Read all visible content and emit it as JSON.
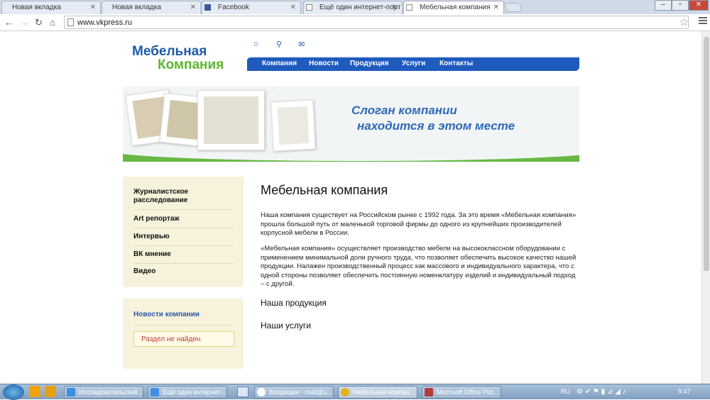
{
  "browser": {
    "tabs": [
      {
        "label": "Новая вкладка"
      },
      {
        "label": "Новая вкладка"
      },
      {
        "label": "Facebook"
      },
      {
        "label": "Ещё один интернет-порт"
      },
      {
        "label": "Мебельная компания"
      }
    ],
    "url": "www.vkpress.ru"
  },
  "site": {
    "logo_line1": "Мебельная",
    "logo_line2": "Компания",
    "nav": [
      "Компания",
      "Новости",
      "Продукция",
      "Услуги",
      "Контакты"
    ],
    "slogan_line1": "Слоган компании",
    "slogan_line2": "находится в этом месте"
  },
  "sidebar": {
    "items": [
      "Журналистское расследование",
      "Art репортаж",
      "Интервью",
      "ВК мнение",
      "Видео"
    ],
    "news_title": "Новости компании",
    "news_message": "Раздел не найден."
  },
  "content": {
    "title": "Мебельная компания",
    "para1": "Наша компания существует на Российском рынке с 1992 года. За это время «Мебельная компания» прошла большой путь от маленькой торговой фирмы до одного из крупнейших производителей корпусной мебели в России.",
    "para2": "«Мебельная компания» осуществляет производство мебели на высококлассном оборудовании с применением минимальной доли ручного труда, что позволяет обеспечить высокое качество нашей продукции. Налажен производственный процесс как массового и индивидуального характера, что с одной стороны позволяет обеспечить постоянную номенклатуру изделий и индивидуальный подход – с другой.",
    "sub1": "Наша продукция",
    "sub2": "Наши услуги"
  },
  "taskbar": {
    "items": [
      {
        "label": "Исследовательский..."
      },
      {
        "label": "Ещё один интернет-..."
      },
      {
        "label": "Входящие - mail@u..."
      },
      {
        "label": "Мебельная компан..."
      },
      {
        "label": "Microsoft Office Pict..."
      }
    ],
    "lang": "RU",
    "time": "9:47"
  },
  "colors": {
    "brand_blue": "#1e5bbd",
    "brand_green": "#5db530",
    "sidebar_bg": "#f6f2dc"
  }
}
